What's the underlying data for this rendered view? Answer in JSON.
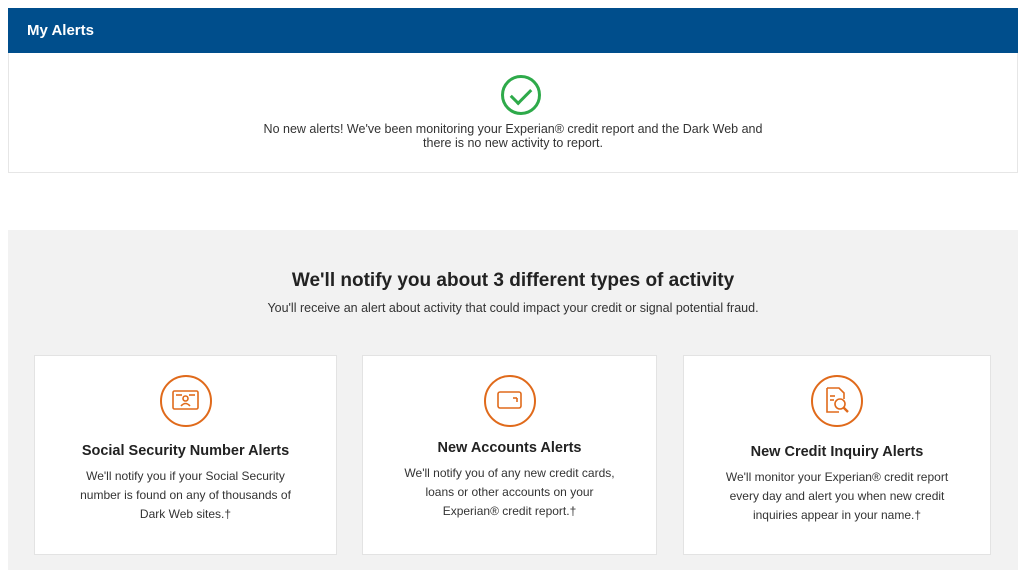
{
  "header": {
    "title": "My Alerts"
  },
  "status": {
    "icon": "check-circle-icon",
    "message_lines": [
      "No new alerts! We've been monitoring your Experian® credit report and the Dark Web and",
      "there is no new activity to report."
    ]
  },
  "activity": {
    "title": "We'll notify you about 3 different types of activity",
    "subtitle": "You'll receive an alert about activity that could impact your credit or signal potential fraud.",
    "cards": [
      {
        "icon": "id-card-icon",
        "title": "Social Security Number Alerts",
        "desc_lines": [
          "We'll notify you if your Social Security",
          "number is found on any of thousands of",
          "Dark Web sites.†"
        ]
      },
      {
        "icon": "credit-card-icon",
        "title": "New Accounts Alerts",
        "desc_lines": [
          "We'll notify you of any new credit cards,",
          "loans or other accounts on your",
          "Experian® credit report.†"
        ]
      },
      {
        "icon": "document-search-icon",
        "title": "New Credit Inquiry Alerts",
        "desc_lines": [
          "We'll monitor your Experian® credit report",
          "every day and alert you when new credit",
          "inquiries appear in your name.†"
        ]
      }
    ]
  },
  "colors": {
    "header_bg": "#004e8c",
    "check_green": "#2eaa4a",
    "icon_orange": "#e06a1b",
    "section_bg": "#f2f2f2"
  }
}
